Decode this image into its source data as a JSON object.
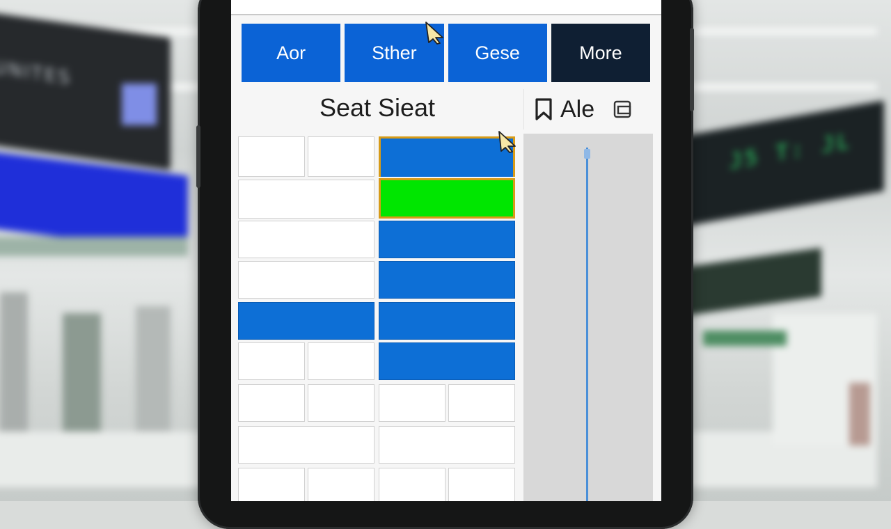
{
  "tabs": [
    {
      "label": "Aor",
      "active": false
    },
    {
      "label": "Sther",
      "active": false
    },
    {
      "label": "Gese",
      "active": false
    },
    {
      "label": "More",
      "active": true
    }
  ],
  "seat_map": {
    "title": "Seat Sieat",
    "legend_colors": {
      "selected": "#0d6fd6",
      "highlighted": "#00e600",
      "available": "#ffffff"
    }
  },
  "side": {
    "label": "Ale",
    "icons": [
      "bookmark-icon",
      "copy-icon"
    ]
  },
  "background": {
    "sign_left": "UNITES",
    "sign_right": "J5 T: JL"
  }
}
